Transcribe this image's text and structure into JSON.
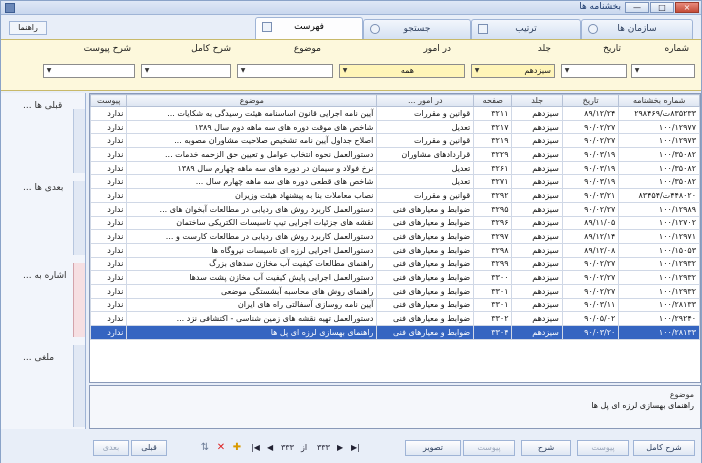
{
  "window": {
    "title": "بخشنامه ها",
    "min_label": "—",
    "max_label": "□",
    "close_label": "×"
  },
  "help_button": "راهنما",
  "tabs": [
    {
      "label": "سازمان ها"
    },
    {
      "label": "ترتیب"
    },
    {
      "label": "جستجو"
    },
    {
      "label": "فهرست"
    }
  ],
  "filters": {
    "number": {
      "label": "شماره",
      "value": ""
    },
    "date": {
      "label": "تاریخ",
      "value": ""
    },
    "volume": {
      "label": "جلد",
      "value": "سیزدهم"
    },
    "in_matters": {
      "label": "در امور",
      "value": "همه"
    },
    "subject": {
      "label": "موضوع",
      "value": ""
    },
    "full_desc": {
      "label": "شرح کامل",
      "value": ""
    },
    "attachment_desc": {
      "label": "شرح پیوست",
      "value": ""
    }
  },
  "sidebar": {
    "previous": "قبلی ها ...",
    "next": "بعدی ها ...",
    "reference": "اشاره به ...",
    "annulled": "ملغی ..."
  },
  "columns": {
    "number": "شماره بخشنامه",
    "date": "تاریخ",
    "volume": "جلد",
    "page": "صفحه",
    "in_matters": "در امور ...",
    "subject": "موضوع",
    "attachment": "پیوست"
  },
  "rows": [
    {
      "number": "۸۳۵۲۳۳ت/۲۹۸۴۶۹",
      "date": "۸۹/۱۲/۲۴",
      "volume": "سیزدهم",
      "page": "۳۲۱۱",
      "in_matters": "قوانین و مقررات",
      "subject": "آیین نامه اجرایی قانون اساسنامه هیئت رسیدگی به شکایات ...",
      "attachment": "ندارد"
    },
    {
      "number": "۱۰۰/۱۲۹۷۷",
      "date": "۹۰/۰۲/۲۷",
      "volume": "سیزدهم",
      "page": "۳۲۱۷",
      "in_matters": "تعدیل",
      "subject": "شاخص های موقت دوره های سه ماهه دوم سال ۱۳۸۹",
      "attachment": "ندارد"
    },
    {
      "number": "۱۰۰/۱۲۹۷۳",
      "date": "۹۰/۰۲/۲۷",
      "volume": "سیزدهم",
      "page": "۳۲۱۹",
      "in_matters": "قوانین و مقررات",
      "subject": "اصلاح جداول آیین نامه تشخیص صلاحیت مشاوران مصوبه ...",
      "attachment": "ندارد"
    },
    {
      "number": "۱۰۰/۳۵۰۸۲",
      "date": "۹۰/۰۳/۱۹",
      "volume": "سیزدهم",
      "page": "۳۲۲۹",
      "in_matters": "قراردادهای مشاوران",
      "subject": "دستورالعمل نحوه انتخاب عوامل و تعیین حق الزحمه خدمات ...",
      "attachment": "ندارد"
    },
    {
      "number": "۱۰۰/۳۵۰۸۲",
      "date": "۹۰/۰۳/۱۹",
      "volume": "سیزدهم",
      "page": "۳۲۶۱",
      "in_matters": "تعدیل",
      "subject": "نرخ فولاد و سیمان در دوره های سه ماهه چهارم سال ۱۳۸۹",
      "attachment": "ندارد"
    },
    {
      "number": "۱۰۰/۳۵۰۸۲",
      "date": "۹۰/۰۳/۱۹",
      "volume": "سیزدهم",
      "page": "۳۲۷۱",
      "in_matters": "تعدیل",
      "subject": "شاخص های قطعی دوره های سه ماهه چهارم سال ...",
      "attachment": "ندارد"
    },
    {
      "number": "۴۴۸۰۲۰ت/۸۳۴۵۴",
      "date": "۹۰/۰۳/۲۱",
      "volume": "سیزدهم",
      "page": "۳۲۹۲",
      "in_matters": "قوانین و مقررات",
      "subject": "نصاب معاملات بنا به پیشنهاد هیئت وزیران",
      "attachment": "ندارد"
    },
    {
      "number": "۱۰۰/۱۲۹۸۹",
      "date": "۹۰/۰۲/۲۷",
      "volume": "سیزدهم",
      "page": "۳۲۹۵",
      "in_matters": "ضوابط و معیارهای فنی",
      "subject": "دستورالعمل کاربرد روش های ردیابی در مطالعات آبخوان های ...",
      "attachment": "ندارد"
    },
    {
      "number": "۱۰۰/۱۲۷۰۲",
      "date": "۸۹/۱۱/۰۵",
      "volume": "سیزدهم",
      "page": "۳۲۹۶",
      "in_matters": "ضوابط و معیارهای فنی",
      "subject": "نقشه های جزئیات اجرایی تیپ تاسیسات الکتریکی ساختمان",
      "attachment": "ندارد"
    },
    {
      "number": "۱۰۰/۱۲۹۷۱",
      "date": "۸۹/۱۲/۱۴",
      "volume": "سیزدهم",
      "page": "۳۲۹۷",
      "in_matters": "ضوابط و معیارهای فنی",
      "subject": "دستورالعمل کاربرد روش های ردیابی در مطالعات کارست و ...",
      "attachment": "ندارد"
    },
    {
      "number": "۱۰۰/۱۵۰۵۳",
      "date": "۸۹/۱۲/۰۸",
      "volume": "سیزدهم",
      "page": "۳۲۹۸",
      "in_matters": "ضوابط و معیارهای فنی",
      "subject": "دستورالعمل اجرایی لرزه ای تاسیسات نیروگاه ها",
      "attachment": "ندارد"
    },
    {
      "number": "۱۰۰/۱۲۹۳۲",
      "date": "۹۰/۰۲/۲۷",
      "volume": "سیزدهم",
      "page": "۳۲۹۹",
      "in_matters": "ضوابط و معیارهای فنی",
      "subject": "راهنمای مطالعات کیفیت آب مخازن سدهای بزرگ",
      "attachment": "ندارد"
    },
    {
      "number": "۱۰۰/۱۲۹۳۲",
      "date": "۹۰/۰۲/۲۷",
      "volume": "سیزدهم",
      "page": "۳۳۰۰",
      "in_matters": "ضوابط و معیارهای فنی",
      "subject": "دستورالعمل اجرایی پایش کیفیت آب مخازن پشت سدها",
      "attachment": "ندارد"
    },
    {
      "number": "۱۰۰/۱۲۹۳۲",
      "date": "۹۰/۰۲/۲۷",
      "volume": "سیزدهم",
      "page": "۳۳۰۱",
      "in_matters": "ضوابط و معیارهای فنی",
      "subject": "راهنمای روش های محاسبه آبشستگی موضعی",
      "attachment": "ندارد"
    },
    {
      "number": "۱۰۰/۲۸۱۳۳",
      "date": "۹۰/۰۳/۱۱",
      "volume": "سیزدهم",
      "page": "۳۳۰۱",
      "in_matters": "ضوابط و معیارهای فنی",
      "subject": "آیین نامه روسازی آسفالتی راه های ایران",
      "attachment": "ندارد"
    },
    {
      "number": "۱۰۰/۲۹۲۴۰",
      "date": "۹۰/۰۵/۰۲",
      "volume": "سیزدهم",
      "page": "۳۳۰۲",
      "in_matters": "ضوابط و معیارهای فنی",
      "subject": "دستورالعمل تهیه نقشه های زمین شناسی - اکتشافی نزد ...",
      "attachment": "ندارد"
    },
    {
      "number": "۱۰۰/۲۸۱۳۳",
      "date": "۹۰/۰۳/۲۰",
      "volume": "سیزدهم",
      "page": "۳۳۰۴",
      "in_matters": "ضوابط و معیارهای فنی",
      "subject": "راهنمای بهسازی لرزه ای پل ها",
      "attachment": "ندارد"
    }
  ],
  "selected_row_index": 16,
  "detail": {
    "label": "موضوع",
    "value": "راهنمای بهسازی لرزه ای پل ها"
  },
  "bottom": {
    "previous_btn": "قبلی",
    "next_btn": "بعدی",
    "total": "۳۳۳",
    "current": "۳۳۳",
    "of_label": "از",
    "image_btn": "تصویر",
    "attachment_btn": "پیوست",
    "desc_btn": "شرح",
    "attachment_btn2": "پیوست",
    "full_desc_btn": "شرح کامل"
  }
}
